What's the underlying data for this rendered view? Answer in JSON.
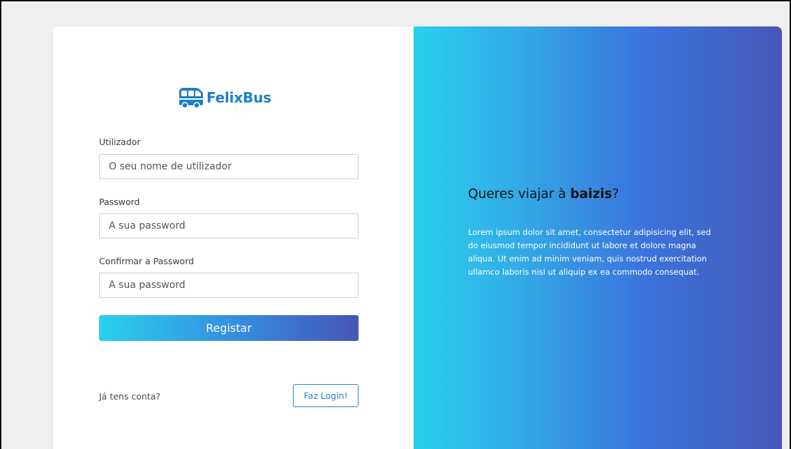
{
  "brand": {
    "name": "FelixBus",
    "color": "#1e7fc9",
    "icon": "bus-icon"
  },
  "form": {
    "username": {
      "label": "Utilizador",
      "placeholder": "O seu nome de utilizador",
      "value": ""
    },
    "password": {
      "label": "Password",
      "placeholder": "A sua password",
      "value": ""
    },
    "confirm_password": {
      "label": "Confirmar a Password",
      "placeholder": "A sua password",
      "value": ""
    },
    "submit_label": "Registar"
  },
  "login_prompt": {
    "text": "Já tens conta?",
    "button_label": "Faz Login!"
  },
  "promo": {
    "headline_prefix": "Queres viajar à ",
    "headline_bold": "baizis",
    "headline_suffix": "?",
    "body": "Lorem ipsum dolor sit amet, consectetur adipisicing elit, sed do eiusmod tempor incididunt ut labore et dolore magna aliqua. Ut enim ad minim veniam, quis nostrud exercitation ullamco laboris nisi ut aliquip ex ea commodo consequat."
  },
  "colors": {
    "gradient_start": "#29d1ec",
    "gradient_mid": "#3a74dc",
    "gradient_end": "#4657b8",
    "login_border": "#2b82d3"
  }
}
